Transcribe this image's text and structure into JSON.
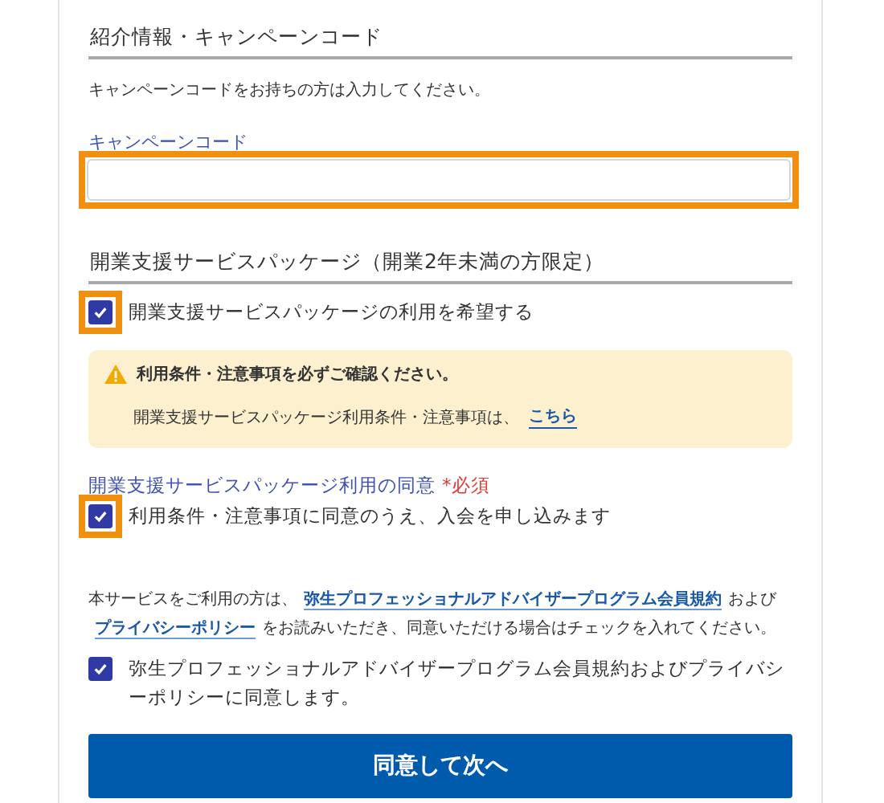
{
  "campaign": {
    "title": "紹介情報・キャンペーンコード",
    "description": "キャンペーンコードをお持ちの方は入力してください。",
    "field_label": "キャンペーンコード",
    "highlighted": true
  },
  "package": {
    "title": "開業支援サービスパッケージ（開業2年未満の方限定）",
    "checkbox": {
      "label": "開業支援サービスパッケージの利用を希望する",
      "checked": true,
      "highlighted": true
    },
    "notice": {
      "title": "利用条件・注意事項を必ずご確認ください。",
      "text": "開業支援サービスパッケージ利用条件・注意事項は、",
      "link": "こちら"
    },
    "consent_label": "開業支援サービスパッケージ利用の同意",
    "required": "*必須",
    "consent": {
      "label": "利用条件・注意事項に同意のうえ、入会を申し込みます",
      "checked": true,
      "highlighted": true
    }
  },
  "terms": {
    "text_parts": [
      {
        "kind": "text",
        "text": "本サービスをご利用の方は、"
      },
      {
        "kind": "link",
        "text": "弥生プロフェッショナルアドバイザープログラム会員規約"
      },
      {
        "kind": "text",
        "text": "および"
      },
      {
        "kind": "link",
        "text": "プライバシーポリシー"
      },
      {
        "kind": "text",
        "text": "をお読みいただき、同意いただける場合はチェックを入れてください。"
      }
    ],
    "checkbox": {
      "label": "弥生プロフェッショナルアドバイザープログラム会員規約およびプライバシーポリシーに同意します。",
      "checked": true,
      "highlighted": false
    }
  },
  "submit": "同意して次へ"
}
